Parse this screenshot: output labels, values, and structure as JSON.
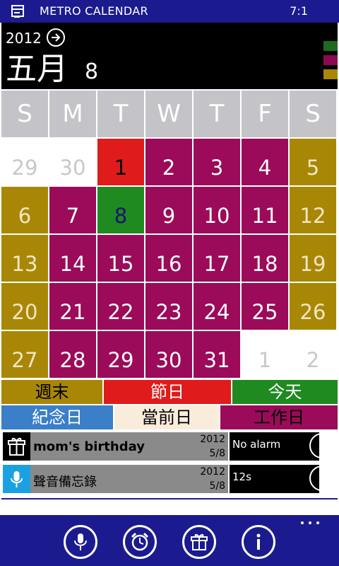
{
  "status_bar": {
    "app_icon": "calendar-icon",
    "title": "METRO CALENDAR",
    "time": "7:1"
  },
  "header": {
    "year": "2012",
    "month": "五月",
    "day": "8",
    "nav_icon": "arrow-right-circle-icon",
    "legend_colors": [
      "#1e6b1e",
      "#8b0a52",
      "#a98706"
    ]
  },
  "weekdays": [
    "S",
    "M",
    "T",
    "W",
    "T",
    "F",
    "S"
  ],
  "colors": {
    "weekend": "#a98706",
    "holiday": "#e01b1b",
    "today": "#1f8a1f",
    "anniversary": "#3a7fc8",
    "current": "#faecdb",
    "workday": "#9b0b59",
    "other_month_text": "#c8c8c8",
    "today_text": "#16166e"
  },
  "calendar": [
    [
      {
        "day": "29",
        "type": "other"
      },
      {
        "day": "30",
        "type": "other"
      },
      {
        "day": "1",
        "type": "holiday"
      },
      {
        "day": "2",
        "type": "workday"
      },
      {
        "day": "3",
        "type": "workday"
      },
      {
        "day": "4",
        "type": "workday"
      },
      {
        "day": "5",
        "type": "weekend"
      }
    ],
    [
      {
        "day": "6",
        "type": "weekend"
      },
      {
        "day": "7",
        "type": "workday"
      },
      {
        "day": "8",
        "type": "today"
      },
      {
        "day": "9",
        "type": "workday"
      },
      {
        "day": "10",
        "type": "workday"
      },
      {
        "day": "11",
        "type": "workday"
      },
      {
        "day": "12",
        "type": "weekend"
      }
    ],
    [
      {
        "day": "13",
        "type": "weekend"
      },
      {
        "day": "14",
        "type": "workday"
      },
      {
        "day": "15",
        "type": "workday"
      },
      {
        "day": "16",
        "type": "workday"
      },
      {
        "day": "17",
        "type": "workday"
      },
      {
        "day": "18",
        "type": "workday"
      },
      {
        "day": "19",
        "type": "weekend"
      }
    ],
    [
      {
        "day": "20",
        "type": "weekend"
      },
      {
        "day": "21",
        "type": "workday"
      },
      {
        "day": "22",
        "type": "workday"
      },
      {
        "day": "23",
        "type": "workday"
      },
      {
        "day": "24",
        "type": "workday"
      },
      {
        "day": "25",
        "type": "workday"
      },
      {
        "day": "26",
        "type": "weekend"
      }
    ],
    [
      {
        "day": "27",
        "type": "weekend"
      },
      {
        "day": "28",
        "type": "workday"
      },
      {
        "day": "29",
        "type": "workday"
      },
      {
        "day": "30",
        "type": "workday"
      },
      {
        "day": "31",
        "type": "workday"
      },
      {
        "day": "1",
        "type": "other"
      },
      {
        "day": "2",
        "type": "other"
      }
    ]
  ],
  "legend": {
    "weekend": "週末",
    "holiday": "節日",
    "today": "今天",
    "anniversary": "紀念日",
    "current": "當前日",
    "workday": "工作日"
  },
  "events": [
    {
      "icon": "gift-icon",
      "icon_bg": "#000000",
      "title": "mom's birthday",
      "year": "2012",
      "date": "5/8",
      "status": "No alarm",
      "action_icon": "candle-icon"
    },
    {
      "icon": "microphone-icon",
      "icon_bg": "#1ba1e2",
      "title": "聲音備忘錄",
      "year": "2012",
      "date": "5/8",
      "status": "12s",
      "action_icon": "play-icon"
    }
  ],
  "app_bar": {
    "buttons": [
      "microphone-icon",
      "alarm-clock-icon",
      "gift-icon",
      "info-icon"
    ],
    "more": "more-dots-icon"
  }
}
